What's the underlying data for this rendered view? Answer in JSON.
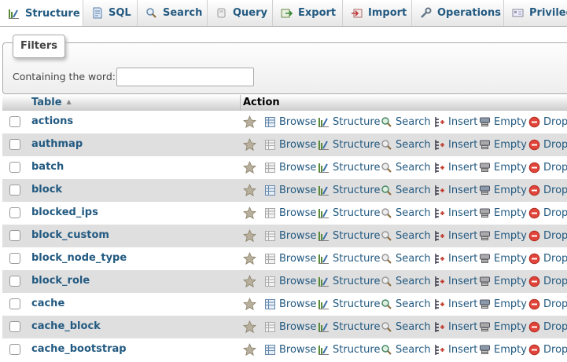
{
  "tabs": [
    {
      "label": "Structure",
      "icon": "structure-icon",
      "active": true
    },
    {
      "label": "SQL",
      "icon": "sql-icon"
    },
    {
      "label": "Search",
      "icon": "search-icon"
    },
    {
      "label": "Query",
      "icon": "query-icon"
    },
    {
      "label": "Export",
      "icon": "export-icon"
    },
    {
      "label": "Import",
      "icon": "import-icon"
    },
    {
      "label": "Operations",
      "icon": "wrench-icon"
    },
    {
      "label": "Privileges",
      "icon": "privileges-icon"
    }
  ],
  "filters": {
    "legend": "Filters",
    "label": "Containing the word:",
    "value": ""
  },
  "table": {
    "col_table": "Table",
    "col_action": "Action",
    "action_labels": {
      "browse": "Browse",
      "structure": "Structure",
      "search": "Search",
      "insert": "Insert",
      "empty": "Empty",
      "drop": "Drop"
    },
    "rows": [
      {
        "name": "actions",
        "has_data": true
      },
      {
        "name": "authmap",
        "has_data": false
      },
      {
        "name": "batch",
        "has_data": false
      },
      {
        "name": "block",
        "has_data": true
      },
      {
        "name": "blocked_ips",
        "has_data": false
      },
      {
        "name": "block_custom",
        "has_data": false
      },
      {
        "name": "block_node_type",
        "has_data": false
      },
      {
        "name": "block_role",
        "has_data": false
      },
      {
        "name": "cache",
        "has_data": true
      },
      {
        "name": "cache_block",
        "has_data": false
      },
      {
        "name": "cache_bootstrap",
        "has_data": true
      }
    ]
  },
  "colors": {
    "link": "#235a81",
    "row_alt": "#dfdfdf",
    "drop_red": "#e0443a",
    "star": "#a89f8c"
  }
}
